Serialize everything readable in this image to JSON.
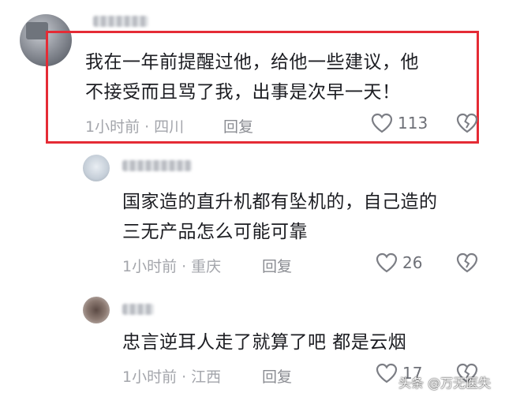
{
  "comments": [
    {
      "text_lines": [
        "我在一年前提醒过他，给他一些建议，他",
        "不接受而且骂了我，出事是次早一天！"
      ],
      "time": "1小时前",
      "location": "四川",
      "reply_label": "回复",
      "likes": "113"
    },
    {
      "text_lines": [
        "国家造的直升机都有坠机的，自己造的",
        "三无产品怎么可能可靠"
      ],
      "time": "1小时前",
      "location": "重庆",
      "reply_label": "回复",
      "likes": "26"
    },
    {
      "text_lines": [
        "忠言逆耳人走了就算了吧 都是云烟"
      ],
      "time": "1小时前",
      "location": "江西",
      "reply_label": "回复",
      "likes": "17"
    }
  ],
  "separator": "·",
  "watermark": "头条 @万无医失",
  "colors": {
    "highlight": "#e52b35",
    "meta": "#a3a5ab",
    "icon": "#7c7e85"
  },
  "icons": [
    "heart-icon",
    "broken-heart-icon"
  ]
}
